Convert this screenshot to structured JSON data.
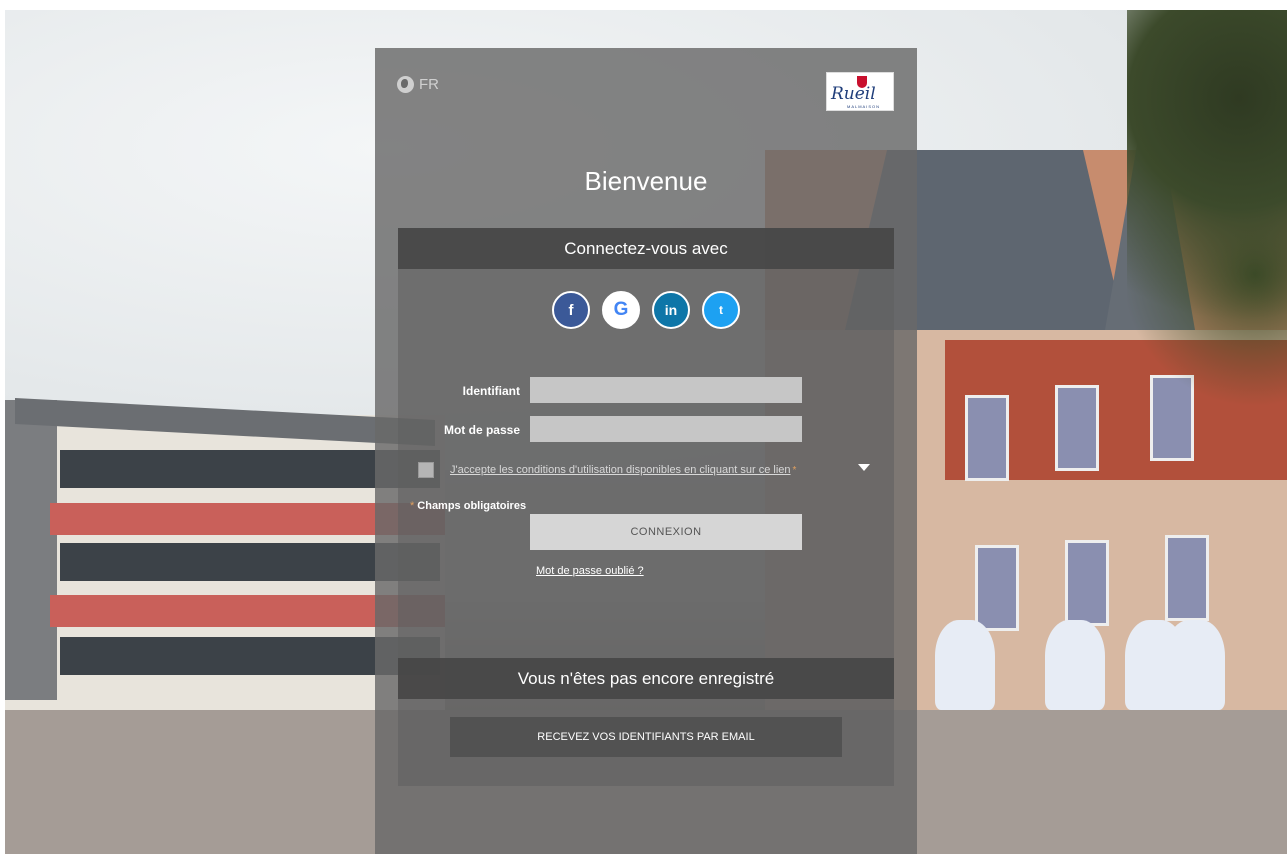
{
  "language": {
    "code": "FR"
  },
  "logo": {
    "brand": "Rueil",
    "subtitle": "MALMAISON"
  },
  "welcome_title": "Bienvenue",
  "login_section": {
    "header": "Connectez-vous avec",
    "social": [
      {
        "icon": "facebook-icon",
        "glyph": "f"
      },
      {
        "icon": "google-icon",
        "glyph": "G"
      },
      {
        "icon": "linkedin-icon",
        "glyph": "in"
      },
      {
        "icon": "twitter-icon",
        "glyph": "t"
      }
    ],
    "identifiant_label": "Identifiant",
    "identifiant_value": "",
    "password_label": "Mot de passe",
    "password_value": "",
    "terms_text": "J'accepte les conditions d'utilisation disponibles en cliquant sur ce lien",
    "required_star": "*",
    "required_note": "Champs obligatoires",
    "connexion_button": "CONNEXION",
    "forgot_link": "Mot de passe oublié ?"
  },
  "register_section": {
    "header": "Vous n'êtes pas encore enregistré",
    "email_button": "RECEVEZ VOS IDENTIFIANTS PAR EMAIL"
  },
  "colors": {
    "facebook": "#3b5998",
    "google": "#4285f4",
    "linkedin": "#0e76a8",
    "twitter": "#1da1f2",
    "required": "#e0a060"
  }
}
